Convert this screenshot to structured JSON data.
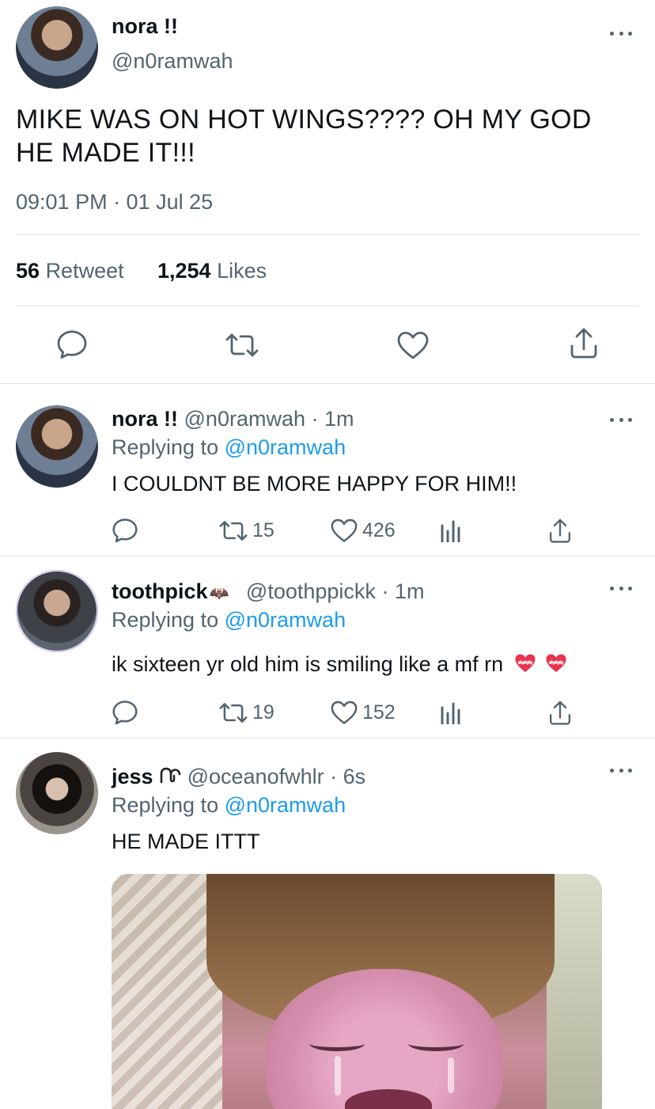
{
  "main_tweet": {
    "display_name": "nora !!",
    "handle": "@n0ramwah",
    "text_line1": "MIKE WAS ON HOT WINGS???? OH MY GOD",
    "text_line2": "HE MADE IT!!!",
    "timestamp": "09:01 PM · 01 Jul 25",
    "retweet_count": "56",
    "retweet_label": "Retweet",
    "like_count": "1,254",
    "like_label": "Likes"
  },
  "replies": [
    {
      "display_name": "nora !!",
      "handle": "@n0ramwah",
      "time": "· 1m",
      "replying_prefix": "Replying to",
      "replying_to": "@n0ramwah",
      "text": "I COULDNT BE MORE HAPPY FOR HIM!!",
      "retweets": "15",
      "likes": "426"
    },
    {
      "display_name": "toothpick",
      "name_emoji": "bat",
      "handle": "@toothppickk",
      "time": "· 1m",
      "replying_prefix": "Replying to",
      "replying_to": "@n0ramwah",
      "text": "ik sixteen yr old him is smiling like a mf rn",
      "text_emoji": "heart-mending x2",
      "retweets": "19",
      "likes": "152"
    },
    {
      "display_name": "jess",
      "name_emoji": "swirl",
      "handle": "@oceanofwhlr",
      "time": "· 6s",
      "replying_prefix": "Replying to",
      "replying_to": "@n0ramwah",
      "text": "HE MADE ITTT"
    }
  ],
  "colors": {
    "accent": "#1d9bf0",
    "secondary_text": "#536471",
    "divider": "#dfe3e6"
  }
}
